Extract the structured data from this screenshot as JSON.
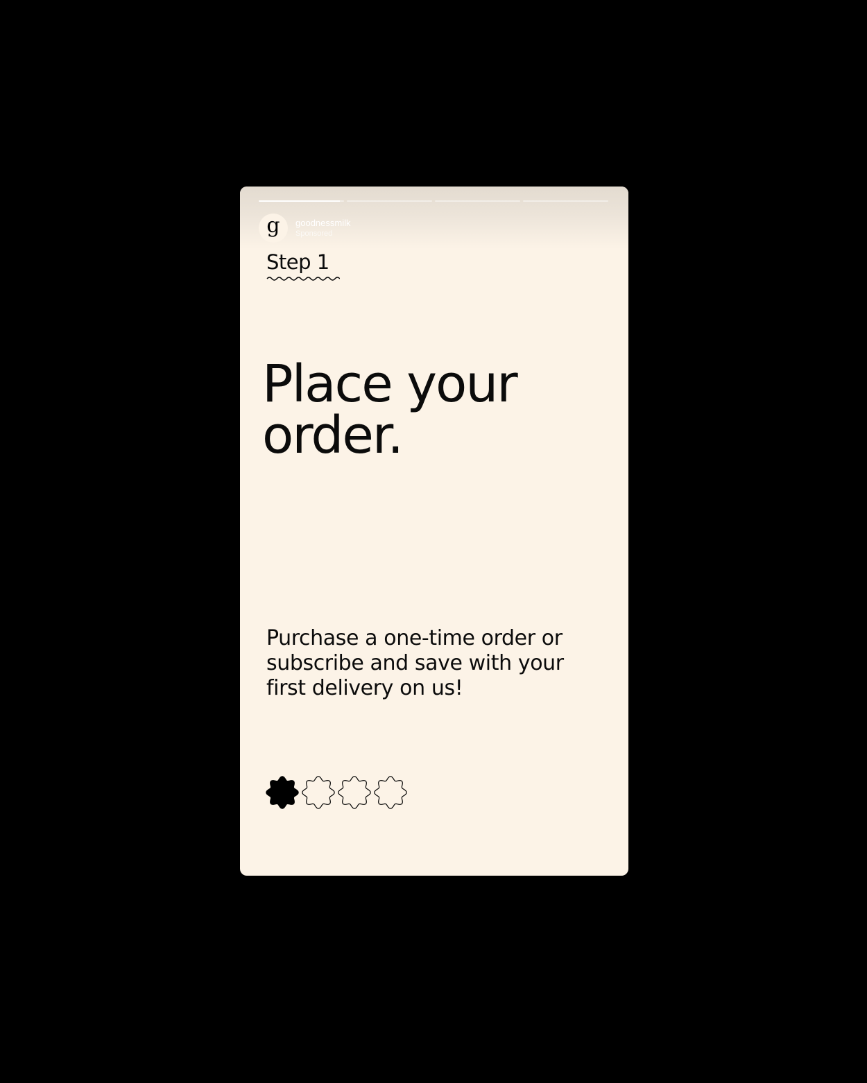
{
  "story": {
    "progress": {
      "total_segments": 4,
      "active_segment": 1,
      "active_fill_fraction": 0.95
    },
    "account": {
      "avatar_letter": "g",
      "name": "goodnessmilk",
      "subtitle": "Sponsored"
    },
    "step_label": "Step 1",
    "headline": "Place your order.",
    "body": "Purchase a one-time order or subscribe and save with your first delivery on us!",
    "pager": {
      "total": 4,
      "current": 1
    }
  },
  "colors": {
    "page_background": "#000000",
    "card_background": "#fcf3e7",
    "text": "#0b0b0b"
  }
}
